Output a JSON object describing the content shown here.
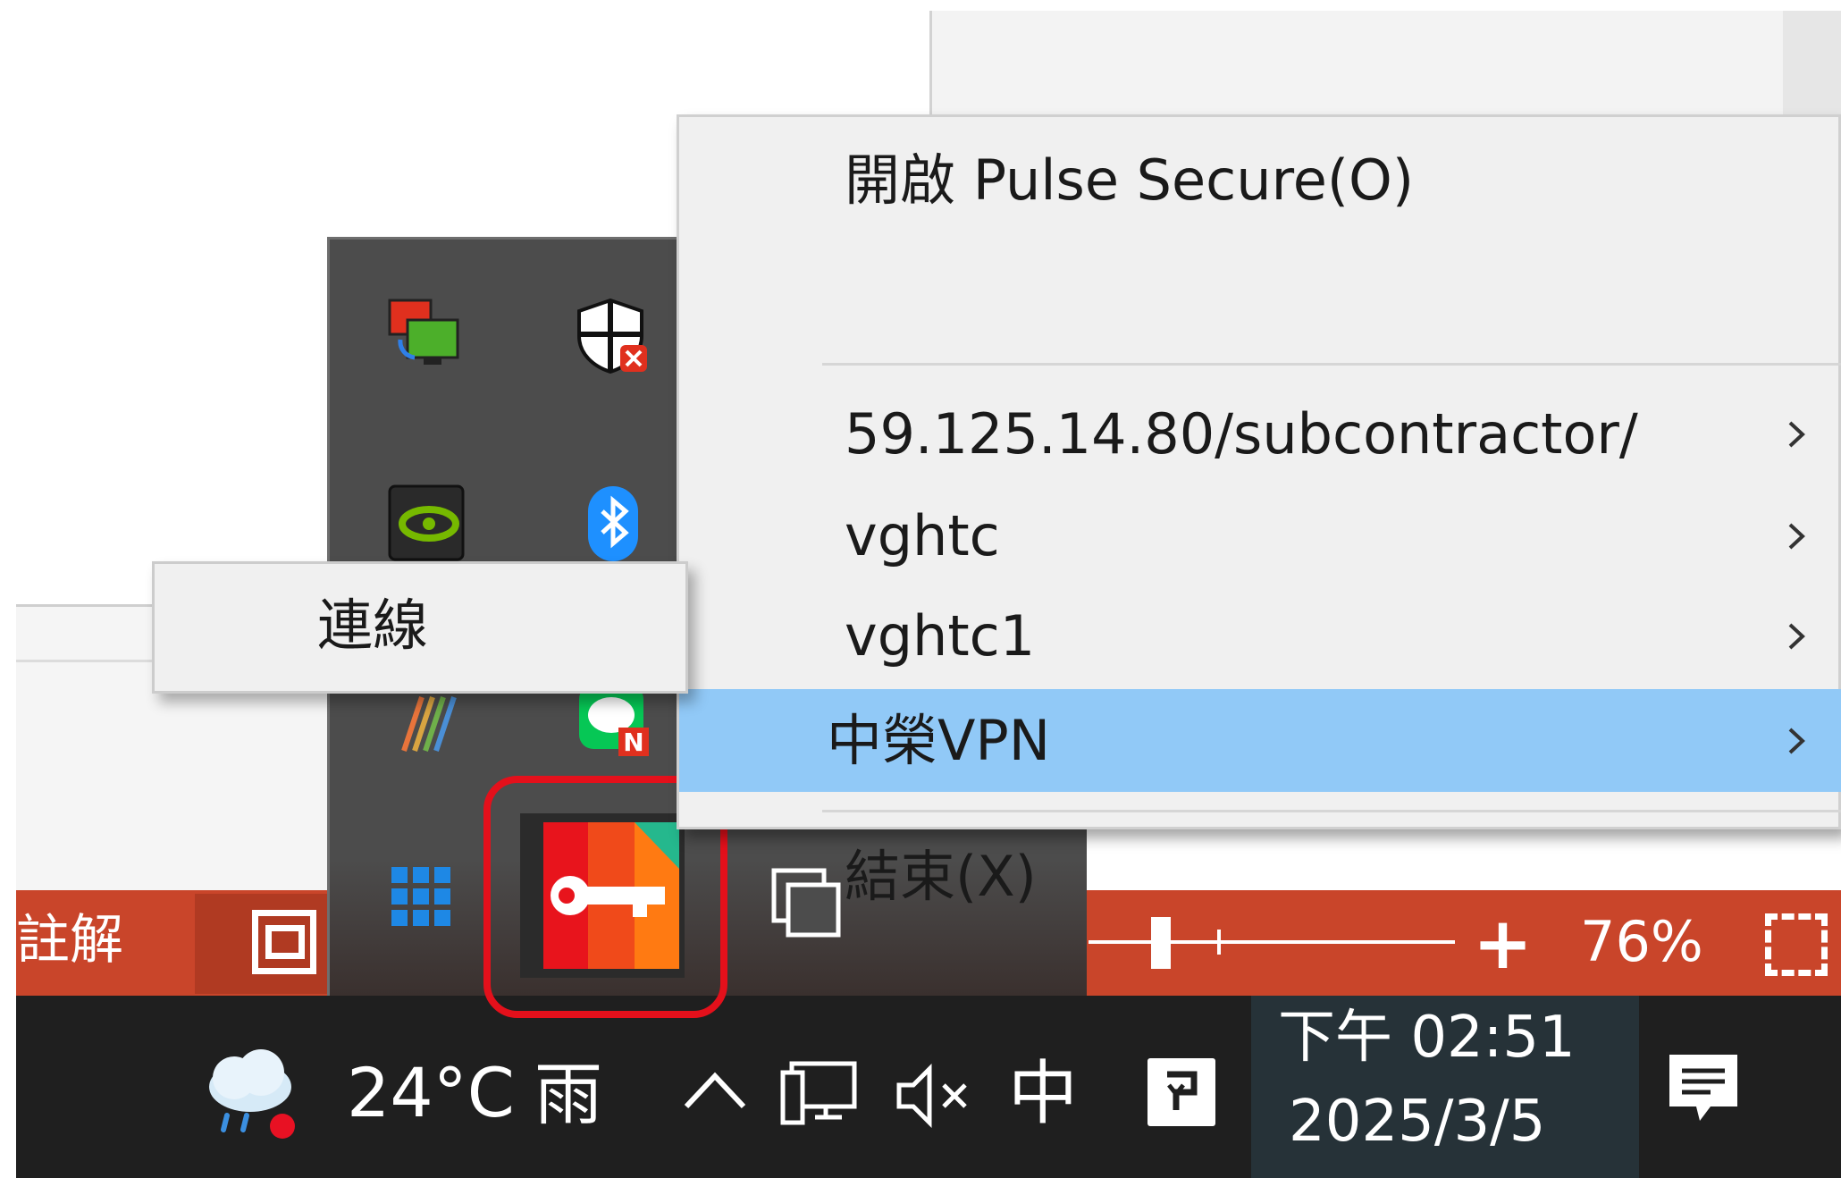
{
  "context_menu": {
    "items": [
      {
        "label": "開啟 Pulse Secure(O)",
        "has_submenu": false
      },
      {
        "label": "59.125.14.80/subcontractor/",
        "has_submenu": true
      },
      {
        "label": "vghtc",
        "has_submenu": true
      },
      {
        "label": "vghtc1",
        "has_submenu": true
      },
      {
        "label": "中榮VPN",
        "has_submenu": true,
        "highlighted": true
      },
      {
        "label": "結束(X)",
        "has_submenu": false
      }
    ]
  },
  "submenu": {
    "items": [
      {
        "label": "連線"
      }
    ]
  },
  "tray_flyout": {
    "icons": [
      "teamviewer-icon",
      "defender-icon",
      "nvidia-icon",
      "bluetooth-icon",
      "color-app-icon",
      "line-icon",
      "grid-app-icon",
      "pulse-secure-icon",
      "copy-app-icon"
    ],
    "highlighted_icon": "pulse-secure-icon"
  },
  "status_bar": {
    "notes_label": "註解",
    "zoom_level": "76%",
    "zoom_plus": "+"
  },
  "taskbar": {
    "weather_temp": "24°C",
    "weather_condition": "雨",
    "ime_indicator": "中",
    "clock_time": "下午 02:51",
    "clock_date": "2025/3/5"
  },
  "colors": {
    "menu_highlight": "#91c9f7",
    "status_bar": "#c9452a",
    "taskbar": "#1f1f1f",
    "highlight_box": "#e4101b"
  }
}
